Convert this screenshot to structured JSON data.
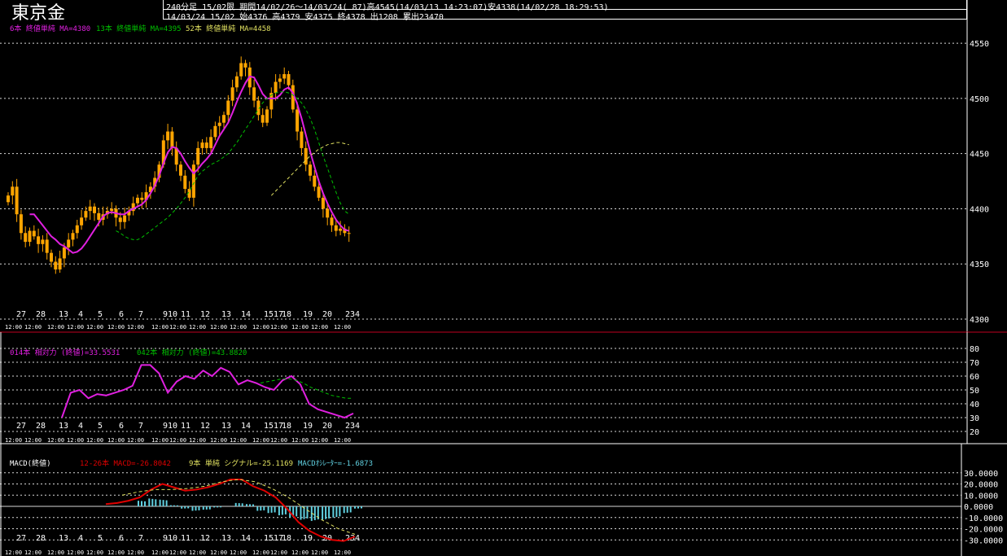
{
  "header": {
    "title": "東京金",
    "line1": "240分足 15/02限  期間14/02/26～14/03/24( 87)高4545(14/03/13 14:23:07)安4338(14/02/28 18:29:53)",
    "line2": "14/03/24 15/02 始4376 高4379 安4375 終4378 出1208 累出23470"
  },
  "colors": {
    "bg": "#000000",
    "up": "#ffa500",
    "ma6": "#e020e0",
    "ma13": "#00c000",
    "ma52": "#e0e060",
    "macd": "#e00000",
    "signal": "#e0e060",
    "osc": "#60d0e0",
    "grid": "#ffffff"
  },
  "legends": {
    "price": [
      {
        "text": "6本 終値単純 MA=4380",
        "color": "#e020e0"
      },
      {
        "text": "13本 終値単純 MA=4395",
        "color": "#00c000"
      },
      {
        "text": "52本 終値単純 MA=4458",
        "color": "#e0e060"
      }
    ],
    "rsi": [
      {
        "text": "014本 相対力 (終値)=33.5531",
        "color": "#e020e0"
      },
      {
        "text": "042本 相対力 (終値)=43.8820",
        "color": "#00c000"
      }
    ],
    "macd": [
      {
        "text": "MACD(終値)",
        "color": "#ffffff"
      },
      {
        "text": "12-26本 MACD=-26.8042",
        "color": "#e00000"
      },
      {
        "text": "9本 単純 シグナル=-25.1169",
        "color": "#e0e060"
      },
      {
        "text": "MACDｵｼﾚｰﾀｰ=-1.6873",
        "color": "#60d0e0"
      }
    ]
  },
  "x_date_labels": [
    "27",
    "28",
    "13",
    "4",
    "5",
    "6",
    "7",
    "910",
    "11",
    "12",
    "13",
    "14",
    "1517",
    "18",
    "19",
    "20",
    "234"
  ],
  "x_time_label": "12:00",
  "chart_data": [
    {
      "type": "candlestick",
      "title": "東京金",
      "ylim": [
        4300,
        4570
      ],
      "yticks": [
        4300,
        4350,
        4400,
        4450,
        4500,
        4550
      ],
      "close": [
        4412,
        4420,
        4395,
        4378,
        4370,
        4380,
        4375,
        4368,
        4372,
        4360,
        4352,
        4345,
        4355,
        4365,
        4372,
        4378,
        4385,
        4392,
        4398,
        4402,
        4396,
        4390,
        4395,
        4398,
        4400,
        4392,
        4388,
        4394,
        4398,
        4405,
        4410,
        4408,
        4415,
        4420,
        4428,
        4440,
        4462,
        4470,
        4455,
        4440,
        4430,
        4418,
        4410,
        4440,
        4455,
        4460,
        4455,
        4465,
        4475,
        4478,
        4485,
        4498,
        4510,
        4520,
        4532,
        4528,
        4510,
        4498,
        4485,
        4478,
        4490,
        4505,
        4515,
        4518,
        4522,
        4512,
        4490,
        4470,
        4455,
        4440,
        4430,
        4420,
        4410,
        4400,
        4392,
        4385,
        4380,
        4382,
        4378,
        4378
      ],
      "ma": [
        {
          "name": "6本 終値単純",
          "color": "#e020e0",
          "values": [
            4395,
            4395,
            4390,
            4385,
            4380,
            4375,
            4372,
            4368,
            4366,
            4363,
            4360,
            4361,
            4364,
            4369,
            4375,
            4381,
            4387,
            4393,
            4396,
            4397,
            4396,
            4395,
            4395,
            4398,
            4400,
            4402,
            4404,
            4408,
            4414,
            4421,
            4430,
            4441,
            4451,
            4456,
            4455,
            4450,
            4443,
            4437,
            4432,
            4436,
            4441,
            4445,
            4450,
            4458,
            4466,
            4472,
            4478,
            4487,
            4497,
            4506,
            4514,
            4520,
            4519,
            4512,
            4504,
            4500,
            4500,
            4500,
            4503,
            4508,
            4510,
            4505,
            4495,
            4482,
            4467,
            4452,
            4438,
            4425,
            4414,
            4405,
            4397,
            4390,
            4385,
            4381,
            4380
          ]
        },
        {
          "name": "13本 終値単純",
          "color": "#00c000",
          "values": [
            4380,
            4378,
            4375,
            4373,
            4372,
            4372,
            4374,
            4377,
            4380,
            4383,
            4386,
            4389,
            4392,
            4396,
            4400,
            4405,
            4410,
            4416,
            4423,
            4430,
            4434,
            4437,
            4440,
            4442,
            4444,
            4447,
            4450,
            4455,
            4460,
            4466,
            4472,
            4478,
            4484,
            4490,
            4496,
            4500,
            4503,
            4505,
            4506,
            4506,
            4505,
            4503,
            4500,
            4496,
            4490,
            4482,
            4472,
            4460,
            4448,
            4437,
            4426,
            4415,
            4405,
            4398,
            4395
          ]
        },
        {
          "name": "52本 終値単純",
          "color": "#e0e060",
          "values": [
            4412,
            4416,
            4420,
            4424,
            4428,
            4432,
            4436,
            4440,
            4444,
            4448,
            4451,
            4454,
            4456,
            4458,
            4459,
            4460,
            4460,
            4459,
            4458
          ]
        }
      ]
    },
    {
      "type": "line",
      "title": "相対力",
      "ylim": [
        20,
        80
      ],
      "yticks": [
        20,
        30,
        40,
        50,
        60,
        70,
        80
      ],
      "series": [
        {
          "name": "014本 相対力 (終値)",
          "color": "#e020e0",
          "values": [
            30,
            48,
            50,
            44,
            47,
            46,
            48,
            50,
            53,
            68,
            68,
            62,
            48,
            56,
            60,
            58,
            64,
            60,
            66,
            63,
            54,
            57,
            55,
            52,
            50,
            57,
            60,
            54,
            40,
            36,
            34,
            32,
            30,
            33
          ]
        },
        {
          "name": "042本 相対力 (終値)",
          "color": "#00c000",
          "values": [
            55,
            56,
            57,
            58,
            58,
            57,
            55,
            52,
            50,
            48,
            46,
            45,
            44,
            44
          ]
        }
      ]
    },
    {
      "type": "line",
      "title": "MACD(終値)",
      "ylim": [
        -32,
        32
      ],
      "yticks": [
        -30,
        -20,
        -10,
        0,
        10,
        20,
        30
      ],
      "series": [
        {
          "name": "12-26本 MACD",
          "color": "#e00000",
          "values": [
            2,
            3,
            5,
            8,
            15,
            20,
            17,
            14,
            15,
            17,
            20,
            24,
            24,
            18,
            14,
            8,
            -2,
            -14,
            -22,
            -27,
            -30,
            -31,
            -27
          ]
        },
        {
          "name": "9本 単純 シグナル",
          "color": "#e0e060",
          "values": [
            10,
            13,
            15,
            15,
            16,
            18,
            22,
            24,
            22,
            16,
            8,
            -2,
            -12,
            -20,
            -25
          ]
        },
        {
          "name": "MACDｵｼﾚｰﾀｰ",
          "color": "#60d0e0",
          "values": [
            5,
            7,
            6,
            1,
            -2,
            -4,
            -3,
            -1,
            0,
            3,
            2,
            -4,
            -6,
            -8,
            -10,
            -12,
            -13,
            -12,
            -10,
            -6,
            -2
          ]
        }
      ]
    }
  ]
}
